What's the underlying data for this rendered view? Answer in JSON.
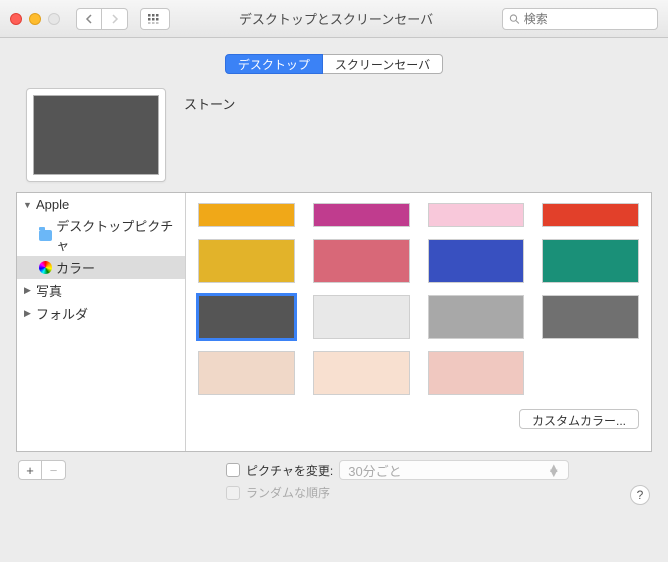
{
  "window": {
    "title": "デスクトップとスクリーンセーバ",
    "search_placeholder": "検索"
  },
  "tabs": {
    "desktop": "デスクトップ",
    "screensaver": "スクリーンセーバ"
  },
  "preview": {
    "name": "ストーン",
    "color": "#555555"
  },
  "sidebar": {
    "apple": "Apple",
    "desktop_pictures": "デスクトップピクチャ",
    "colors": "カラー",
    "photos": "写真",
    "folders": "フォルダ"
  },
  "swatches": {
    "row0": [
      "#F0A818",
      "#C03C8E",
      "#F8C8DA",
      "#E2402A"
    ],
    "row1": [
      "#E2B32A",
      "#D86878",
      "#3850C0",
      "#1A9078"
    ],
    "row2": [
      "#555555",
      "#E8E8E8",
      "#A8A8A8",
      "#707070"
    ],
    "row3": [
      "#F0D8C8",
      "#F8E0D0",
      "#F0C8C0",
      ""
    ]
  },
  "selected_swatch": "2.0",
  "buttons": {
    "custom_color": "カスタムカラー...",
    "add": "+",
    "remove": "−"
  },
  "options": {
    "change_picture": "ピクチャを変更:",
    "interval": "30分ごと",
    "random": "ランダムな順序"
  },
  "help": "?"
}
